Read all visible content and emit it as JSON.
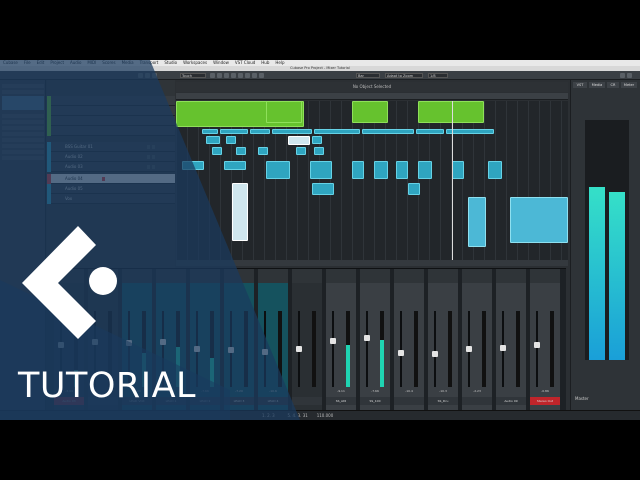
{
  "menubar": {
    "items": [
      "Cubase",
      "File",
      "Edit",
      "Project",
      "Audio",
      "MIDI",
      "Scores",
      "Media",
      "Transport",
      "Studio",
      "Workspaces",
      "Window",
      "VST Cloud",
      "Hub",
      "Help"
    ]
  },
  "window": {
    "title": "Cubase Pro Project - Mixer Tutorial"
  },
  "toolbar": {
    "automation_mode": "Touch",
    "grid": "Bar",
    "zoom": "Adapt to Zoom",
    "quantize": "1/8"
  },
  "arrange": {
    "event_status": "No Object Selected"
  },
  "tracks": [
    {
      "name": "",
      "color": "#66c22e"
    },
    {
      "name": "",
      "color": "#66c22e"
    },
    {
      "name": "",
      "color": "#66c22e"
    },
    {
      "name": "",
      "color": "#66c22e"
    },
    {
      "name": "BSS Guitar 01",
      "color": "#2fa5c0"
    },
    {
      "name": "Audio 02",
      "color": "#2fa5c0"
    },
    {
      "name": "Audio 03",
      "color": "#2fa5c0"
    },
    {
      "name": "Audio 04",
      "color": "#e03a3a"
    },
    {
      "name": "Audio 05",
      "color": "#2fa5c0"
    },
    {
      "name": "Vox",
      "color": "#2fa5c0"
    }
  ],
  "mixer": {
    "channels": [
      {
        "name": "Audio 03",
        "value": "-3.44",
        "level": 0.22,
        "fader": 0.55,
        "tint": "#2a2f33"
      },
      {
        "name": "",
        "value": "",
        "level": 0.0,
        "fader": 0.6,
        "tint": "#2a2f33"
      },
      {
        "name": "LEAD VOX",
        "value": "-0.20",
        "level": 0.45,
        "fader": 0.58,
        "tint": "#15525e"
      },
      {
        "name": "LEAD 1",
        "value": "-0.27",
        "level": 0.52,
        "fader": 0.6,
        "tint": "#15525e"
      },
      {
        "name": "LEAD 2",
        "value": "-7.66",
        "level": 0.38,
        "fader": 0.5,
        "tint": "#15525e"
      },
      {
        "name": "LEAD 3",
        "value": "-7.20",
        "level": 0.0,
        "fader": 0.48,
        "tint": "#15525e"
      },
      {
        "name": "LEAD 4",
        "value": "-10.6",
        "level": 0.0,
        "fader": 0.45,
        "tint": "#15525e"
      },
      {
        "name": "",
        "value": "",
        "level": 0.0,
        "fader": 0.5,
        "tint": "#2a2f33"
      },
      {
        "name": "SS_ADI",
        "value": "-9.11",
        "level": 0.55,
        "fader": 0.62,
        "tint": "#3a3f44"
      },
      {
        "name": "SS_100",
        "value": "-7.66",
        "level": 0.62,
        "fader": 0.66,
        "tint": "#3a3f44"
      },
      {
        "name": "",
        "value": "-10.4",
        "level": 0.0,
        "fader": 0.44,
        "tint": "#3a3f44"
      },
      {
        "name": "SS_Dru",
        "value": "-10.3",
        "level": 0.0,
        "fader": 0.43,
        "tint": "#3a3f44"
      },
      {
        "name": "",
        "value": "-2.23",
        "level": 0.0,
        "fader": 0.5,
        "tint": "#3a3f44"
      },
      {
        "name": "Audio 09",
        "value": "",
        "level": 0.0,
        "fader": 0.52,
        "tint": "#3a3f44"
      },
      {
        "name": "Stereo Out",
        "value": "-0.86",
        "level": 0.0,
        "fader": 0.56,
        "tint": "#3a3f44"
      }
    ]
  },
  "rightzone": {
    "tabs": [
      "VST",
      "Media",
      "CR",
      "Meter"
    ],
    "meter_levels": [
      0.82,
      0.82
    ],
    "meter_fill": [
      0.72,
      0.7
    ],
    "loudness_label": "Master"
  },
  "statusbar": {
    "position": "1. 2. 3",
    "time": "5. 4. 3. 31",
    "tempo": "110.000"
  },
  "overlay": {
    "label": "TUTORIAL",
    "brand_color": "#1a3a5e",
    "accent_color": "#ffffff"
  }
}
